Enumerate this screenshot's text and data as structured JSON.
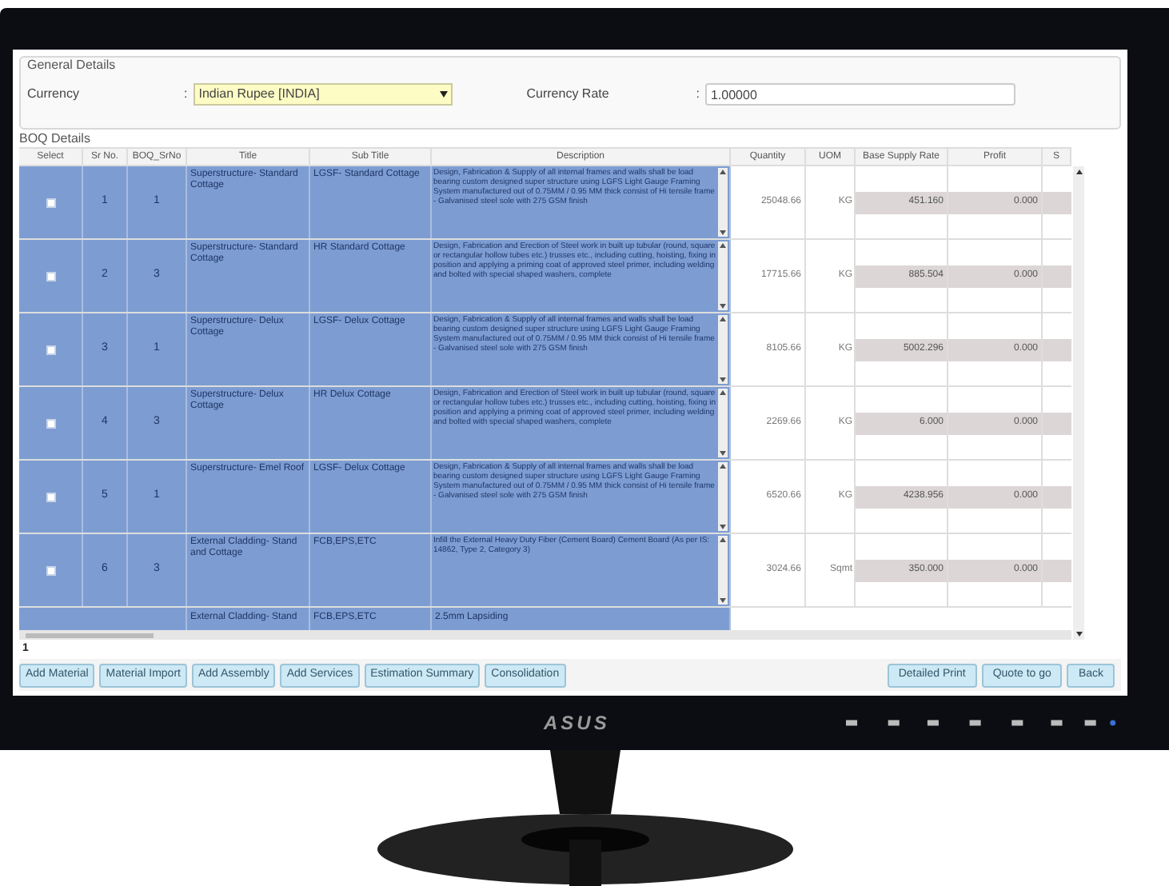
{
  "general_details": {
    "legend": "General Details",
    "currency_label": "Currency",
    "currency_colon": ":",
    "currency_value": "Indian Rupee [INDIA]",
    "currency_rate_label": "Currency Rate",
    "currency_rate_colon": ":",
    "currency_rate_value": "1.00000"
  },
  "boq_details": {
    "legend": "BOQ Details",
    "columns": [
      "Select",
      "Sr No.",
      "BOQ_SrNo",
      "Title",
      "Sub Title",
      "Description",
      "Quantity",
      "UOM",
      "Base Supply Rate",
      "Profit",
      "S"
    ],
    "rows": [
      {
        "selected": true,
        "checked": false,
        "sr_no": "1",
        "boq_sr_no": "1",
        "title": "Superstructure- Standard Cottage",
        "sub_title": "LGSF- Standard Cottage",
        "description": "Design, Fabrication & Supply of all internal frames and walls shall be load bearing custom designed super structure using LGFS Light Gauge Framing System manufactured out of 0.75MM / 0.95 MM thick consist of Hi tensile frame - Galvanised steel sole with 275 GSM finish",
        "quantity": "25048.66",
        "uom": "KG",
        "base_supply_rate": "451.160",
        "profit": "0.000"
      },
      {
        "selected": true,
        "checked": false,
        "sr_no": "2",
        "boq_sr_no": "3",
        "title": "Superstructure- Standard Cottage",
        "sub_title": "HR Standard Cottage",
        "description": "Design, Fabrication and Erection of Steel work in built up tubular (round, square or rectangular hollow tubes etc.) trusses etc., including cutting, hoisting, fixing in position and applying a priming coat of approved steel primer, including welding and bolted with special shaped washers, complete",
        "quantity": "17715.66",
        "uom": "KG",
        "base_supply_rate": "885.504",
        "profit": "0.000"
      },
      {
        "selected": true,
        "checked": false,
        "sr_no": "3",
        "boq_sr_no": "1",
        "title": "Superstructure- Delux Cottage",
        "sub_title": "LGSF- Delux Cottage",
        "description": "Design, Fabrication & Supply of all internal frames and walls shall be load bearing custom designed super structure using LGFS Light Gauge Framing System manufactured out of 0.75MM / 0.95 MM thick consist of Hi tensile frame - Galvanised steel sole with 275 GSM finish",
        "quantity": "8105.66",
        "uom": "KG",
        "base_supply_rate": "5002.296",
        "profit": "0.000"
      },
      {
        "selected": true,
        "checked": false,
        "sr_no": "4",
        "boq_sr_no": "3",
        "title": "Superstructure- Delux Cottage",
        "sub_title": "HR Delux Cottage",
        "description": "Design, Fabrication and Erection of Steel work in built up tubular (round, square or rectangular hollow tubes etc.) trusses etc., including cutting, hoisting, fixing in position and applying a priming coat of approved steel primer, including welding and bolted with special shaped washers, complete",
        "quantity": "2269.66",
        "uom": "KG",
        "base_supply_rate": "6.000",
        "profit": "0.000"
      },
      {
        "selected": true,
        "checked": false,
        "sr_no": "5",
        "boq_sr_no": "1",
        "title": "Superstructure- Emel Roof",
        "sub_title": "LGSF- Delux Cottage",
        "description": "Design, Fabrication & Supply of all internal frames and walls shall be load bearing custom designed super structure using LGFS Light Gauge Framing System manufactured out of 0.75MM / 0.95 MM thick consist of Hi tensile frame - Galvanised steel sole with 275 GSM finish",
        "quantity": "6520.66",
        "uom": "KG",
        "base_supply_rate": "4238.956",
        "profit": "0.000"
      },
      {
        "selected": true,
        "checked": false,
        "sr_no": "6",
        "boq_sr_no": "3",
        "title": "External Cladding- Stand and Cottage",
        "sub_title": "FCB,EPS,ETC",
        "description": "Infill the External Heavy Duty Fiber (Cement Board) Cement Board (As per IS: 14862, Type 2, Category 3)",
        "quantity": "3024.66",
        "uom": "Sqmt",
        "base_supply_rate": "350.000",
        "profit": "0.000"
      }
    ],
    "partial_row": {
      "title": "External Cladding- Stand",
      "sub_title": "FCB,EPS,ETC",
      "description": "2.5mm Lapsiding"
    }
  },
  "pager": [
    "1"
  ],
  "buttons_left": [
    "Add Material",
    "Material Import",
    "Add Assembly",
    "Add Services",
    "Estimation Summary",
    "Consolidation"
  ],
  "buttons_right": [
    "Detailed Print",
    "Quote to go",
    "Back"
  ],
  "monitor": {
    "logo": "ASUS"
  }
}
